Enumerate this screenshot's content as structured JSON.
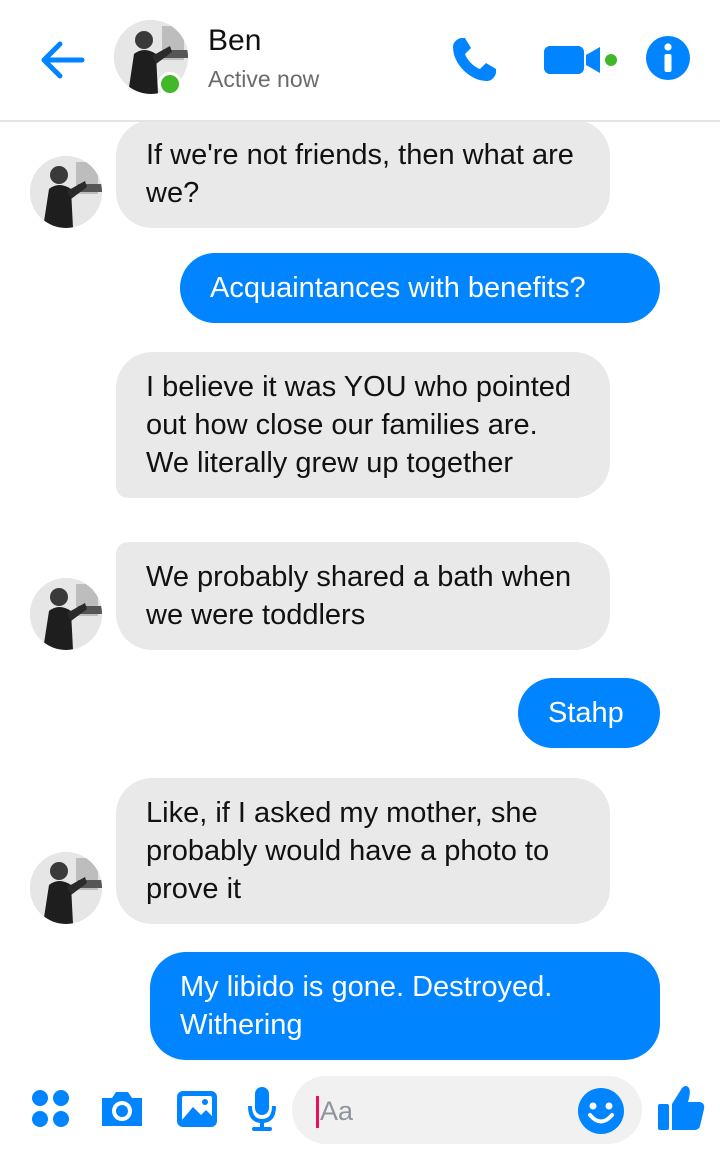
{
  "header": {
    "contact_name": "Ben",
    "status": "Active now",
    "accent_color": "#0084ff",
    "online_color": "#42b72a"
  },
  "messages": [
    {
      "direction": "incoming",
      "text": "If we're not friends, then what are we?"
    },
    {
      "direction": "outgoing",
      "text": "Acquaintances with benefits?"
    },
    {
      "direction": "incoming",
      "text": "I believe it was YOU who pointed out how close our families are. We literally grew up together"
    },
    {
      "direction": "incoming",
      "text": "We probably shared a bath when we were toddlers"
    },
    {
      "direction": "outgoing",
      "text": "Stahp"
    },
    {
      "direction": "incoming",
      "text": "Like, if I asked my mother, she probably would have a photo to prove it"
    },
    {
      "direction": "outgoing",
      "text": "My libido is gone. Destroyed. Withering"
    }
  ],
  "composer": {
    "placeholder": "Aa",
    "icons": [
      "more-icon",
      "camera-icon",
      "gallery-icon",
      "microphone-icon",
      "emoji-icon",
      "thumbs-up-icon"
    ]
  }
}
